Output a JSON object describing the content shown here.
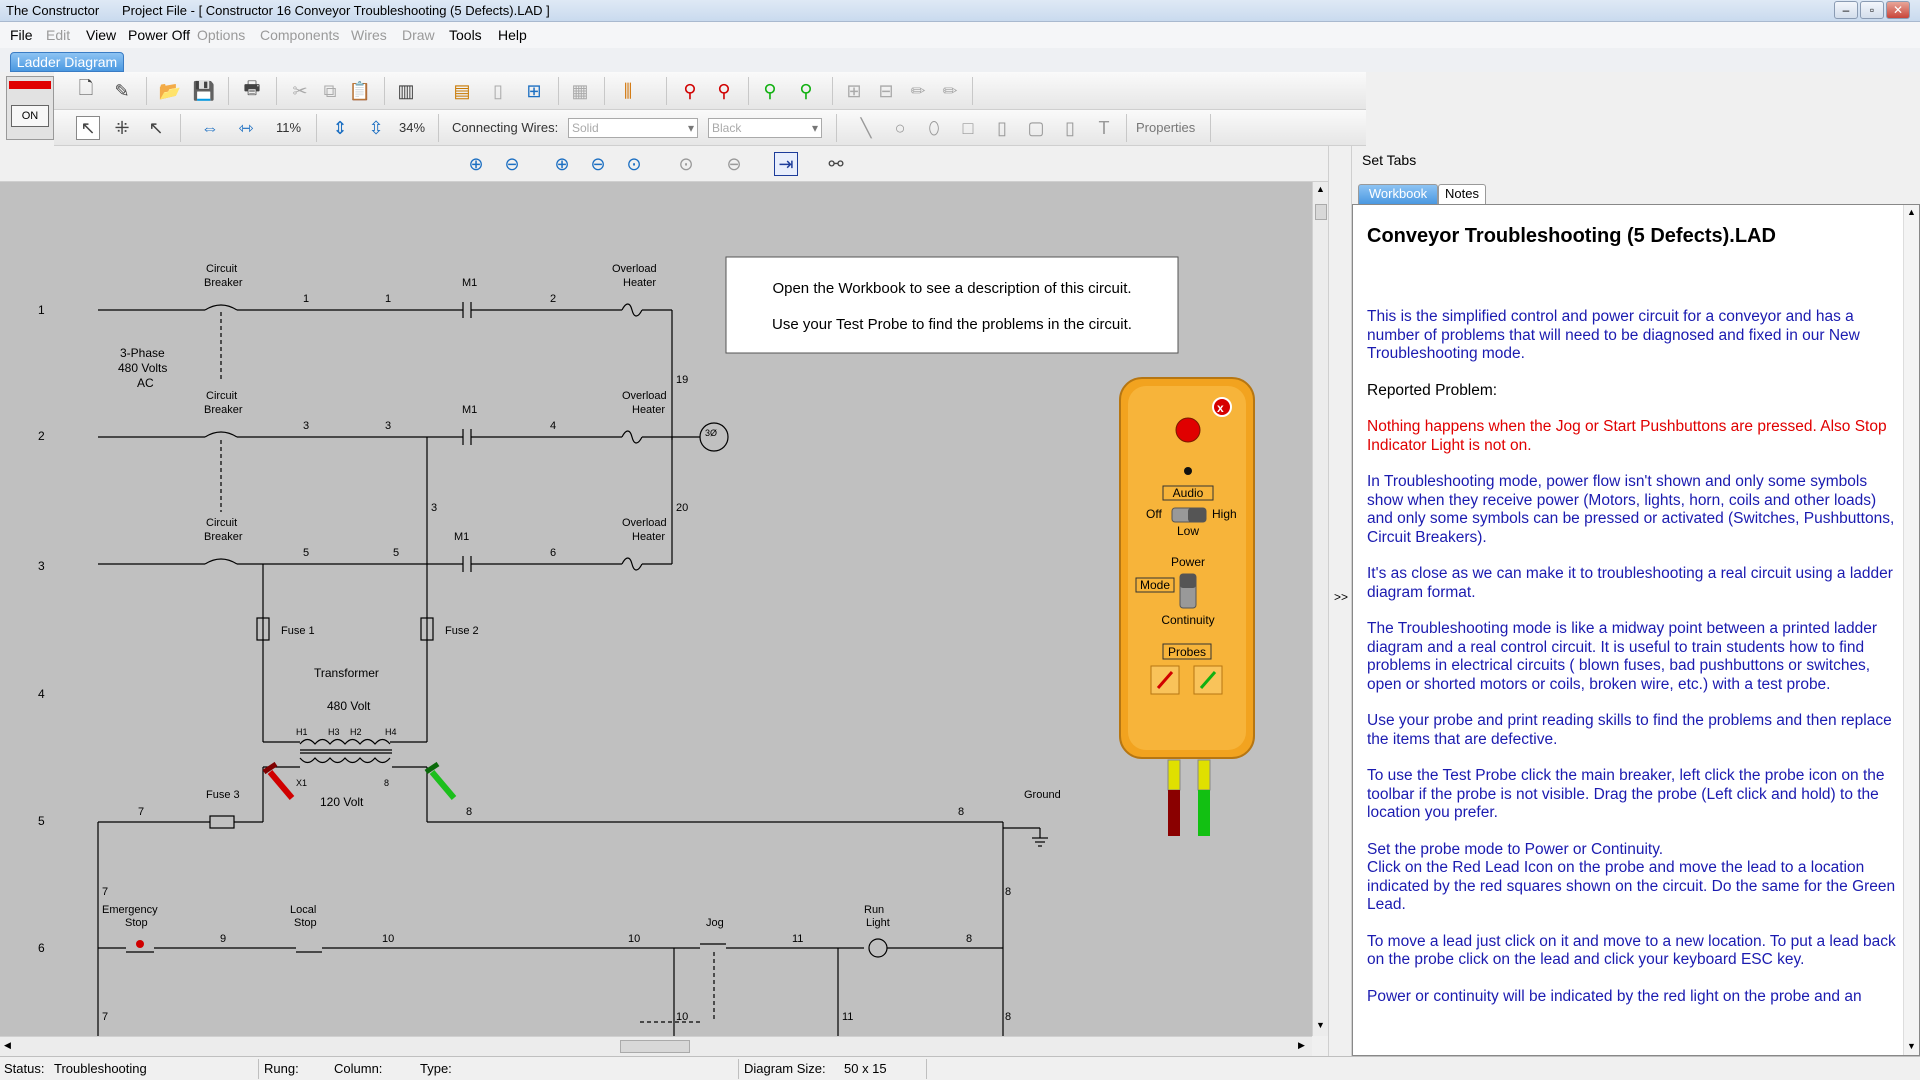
{
  "window": {
    "app_title": "The Constructor",
    "doc_title": "Project File - [ Constructor 16 Conveyor Troubleshooting (5 Defects).LAD ]"
  },
  "menu": {
    "file": "File",
    "edit": "Edit",
    "view": "View",
    "power": "Power Off",
    "options": "Options",
    "components": "Components",
    "wires": "Wires",
    "draw": "Draw",
    "tools": "Tools",
    "help": "Help"
  },
  "tabs": {
    "ladder": "Ladder Diagram"
  },
  "toolbar": {
    "on_label": "ON",
    "zoom_h": "11%",
    "zoom_v": "34%",
    "connecting_wires": "Connecting Wires:",
    "wire_style": "Solid",
    "wire_color": "Black",
    "properties": "Properties"
  },
  "canvas": {
    "rungs": [
      "1",
      "2",
      "3",
      "4",
      "5",
      "6"
    ],
    "info_line1": "Open the Workbook to see a description of this circuit.",
    "info_line2": "Use your Test Probe to find the problems in the circuit.",
    "labels": {
      "circuit": "Circuit",
      "breaker": "Breaker",
      "overload": "Overload",
      "heater": "Heater",
      "m1": "M1",
      "three_phase": "3-Phase",
      "volts480": "480 Volts",
      "ac": "AC",
      "fuse1": "Fuse 1",
      "fuse2": "Fuse 2",
      "fuse3": "Fuse 3",
      "transformer": "Transformer",
      "volt480": "480 Volt",
      "volt120": "120 Volt",
      "h1": "H1",
      "h3": "H3",
      "h2": "H2",
      "h4": "H4",
      "x1": "X1",
      "ground": "Ground",
      "emergency": "Emergency",
      "stop": "Stop",
      "local": "Local",
      "jog": "Jog",
      "run": "Run",
      "light": "Light",
      "motor": "3Ø",
      "w1": "1",
      "w2": "2",
      "w3": "3",
      "w4": "4",
      "w5": "5",
      "w6": "6",
      "w7": "7",
      "w8": "8",
      "w9": "9",
      "w10": "10",
      "w11": "11",
      "w19": "19",
      "w20": "20"
    }
  },
  "probe": {
    "audio": "Audio",
    "off": "Off",
    "high": "High",
    "low": "Low",
    "power": "Power",
    "mode": "Mode",
    "continuity": "Continuity",
    "probes": "Probes"
  },
  "splitter": ">>",
  "right_panel": {
    "title": "Set Tabs",
    "tab_workbook": "Workbook",
    "tab_notes": "Notes",
    "heading": "Conveyor Troubleshooting (5 Defects).LAD",
    "p1": "This is the simplified control and power circuit for a conveyor and has a number of problems that will need to be diagnosed and fixed in our New Troubleshooting mode.",
    "reported": "Reported Problem:",
    "problem": "Nothing happens when the Jog or Start Pushbuttons are pressed. Also Stop Indicator Light is not on.",
    "p2": "In Troubleshooting mode, power flow isn't shown and only some symbols show when they receive power (Motors, lights, horn, coils and other loads) and only some symbols can be pressed or activated (Switches, Pushbuttons, Circuit Breakers).",
    "p3": "It's as close as we can make it to troubleshooting a real circuit using a ladder diagram format.",
    "p4": "The Troubleshooting mode is like a midway point between a printed ladder diagram and a real control circuit. It is useful to train students how to find problems in electrical circuits ( blown fuses, bad pushbuttons or switches, open or shorted motors or coils, broken wire, etc.) with a test probe.",
    "p5": "Use your probe and print reading skills to find the problems and then replace the items that are defective.",
    "p6": "To use the Test Probe click the main breaker, left click the probe icon on the toolbar if the probe is not visible. Drag the probe (Left click and hold) to the location you prefer.",
    "p7": "Set the probe mode to Power or Continuity.\nClick on the Red Lead Icon on the probe and  move the lead to a location indicated by the red squares shown on the circuit. Do the same for the Green Lead.",
    "p8": "To move a lead just click on it and move to a new location. To put a lead back on the probe click on the lead and click your keyboard ESC key.",
    "p9": "Power or continuity will be indicated by the red light on the probe and an"
  },
  "status": {
    "status_label": "Status:",
    "status_value": "Troubleshooting",
    "rung": "Rung:",
    "column": "Column:",
    "type": "Type:",
    "diagram_size_label": "Diagram Size:",
    "diagram_size": "50 x 15"
  }
}
